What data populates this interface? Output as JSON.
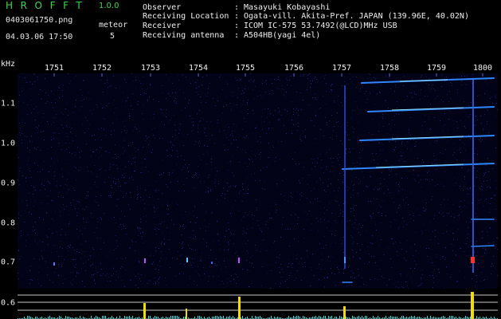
{
  "header": {
    "app_title": "HROFFT",
    "version": "1.0.0",
    "file_name": "0403061750.png",
    "timestamp": "04.03.06 17:50",
    "meteor_label": "meteor",
    "meteor_count": "5"
  },
  "station_info": [
    {
      "label": "Observer",
      "sep": ":",
      "value": "Masayuki Kobayashi"
    },
    {
      "label": "Receiving Location",
      "sep": ":",
      "value": "Ogata-vill. Akita-Pref. JAPAN (139.96E, 40.02N)"
    },
    {
      "label": "Receiver",
      "sep": ":",
      "value": "ICOM IC-575 53.7492(@LCD)MHz USB"
    },
    {
      "label": "Receiving antenna",
      "sep": ":",
      "value": "A504HB(yagi 4el)"
    }
  ],
  "axes": {
    "freq_unit": "kHz",
    "time_ticks": [
      "1751",
      "1752",
      "1753",
      "1754",
      "1755",
      "1756",
      "1757",
      "1758",
      "1759",
      "1800"
    ],
    "freq_ticks": [
      "1.1",
      "1.0",
      "0.9",
      "0.8",
      "0.7",
      "0.6"
    ]
  },
  "colors": {
    "title": "#39d84a",
    "background": "#000000",
    "plot_background": "#030318",
    "noise": "#2a2aa0",
    "echo": "#3fa0ff",
    "panel_lines": "#c8c8c8",
    "activity_baseline": "#3cd8e8",
    "activity_peak": "#f0e000"
  }
}
